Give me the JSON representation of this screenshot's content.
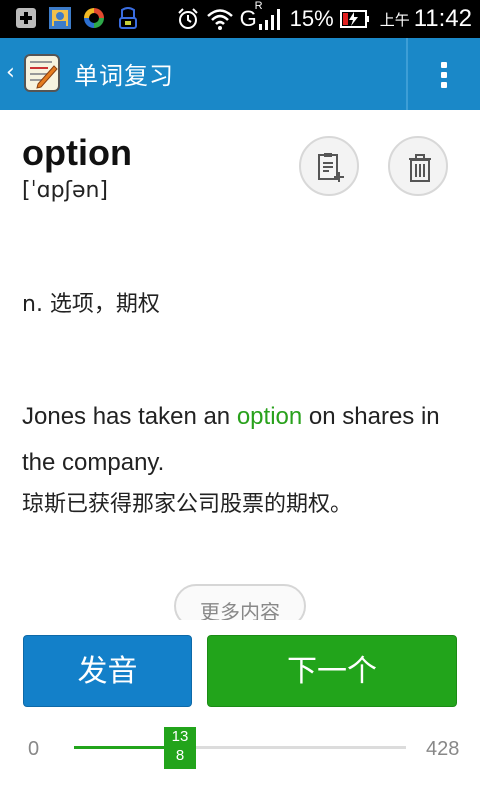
{
  "status_bar": {
    "battery_percent": "15%",
    "am_pm": "上午",
    "time": "11:42",
    "network_type": "G",
    "roaming": "R"
  },
  "action_bar": {
    "back_glyph": "‹",
    "title": "单词复习",
    "color": "#1a88c8"
  },
  "word": {
    "text": "option",
    "phonetic": "[ˈɑpʃən]",
    "definition": "n. 选项，期权"
  },
  "example": {
    "before": "Jones has taken an ",
    "highlight": "option",
    "after": " on shares in the company.",
    "highlight_color": "#29a11c",
    "translation": "琼斯已获得那家公司股票的期权。"
  },
  "more_label": "更多内容",
  "buttons": {
    "speak": "发音",
    "next": "下一个"
  },
  "progress": {
    "min": "0",
    "max": "428",
    "current_line1": "13",
    "current_line2": "8",
    "current_value": 138,
    "total": 428
  },
  "icons": {
    "add": "add-to-wordbook-icon",
    "delete": "trash-icon",
    "overflow": "more-vert-icon"
  }
}
